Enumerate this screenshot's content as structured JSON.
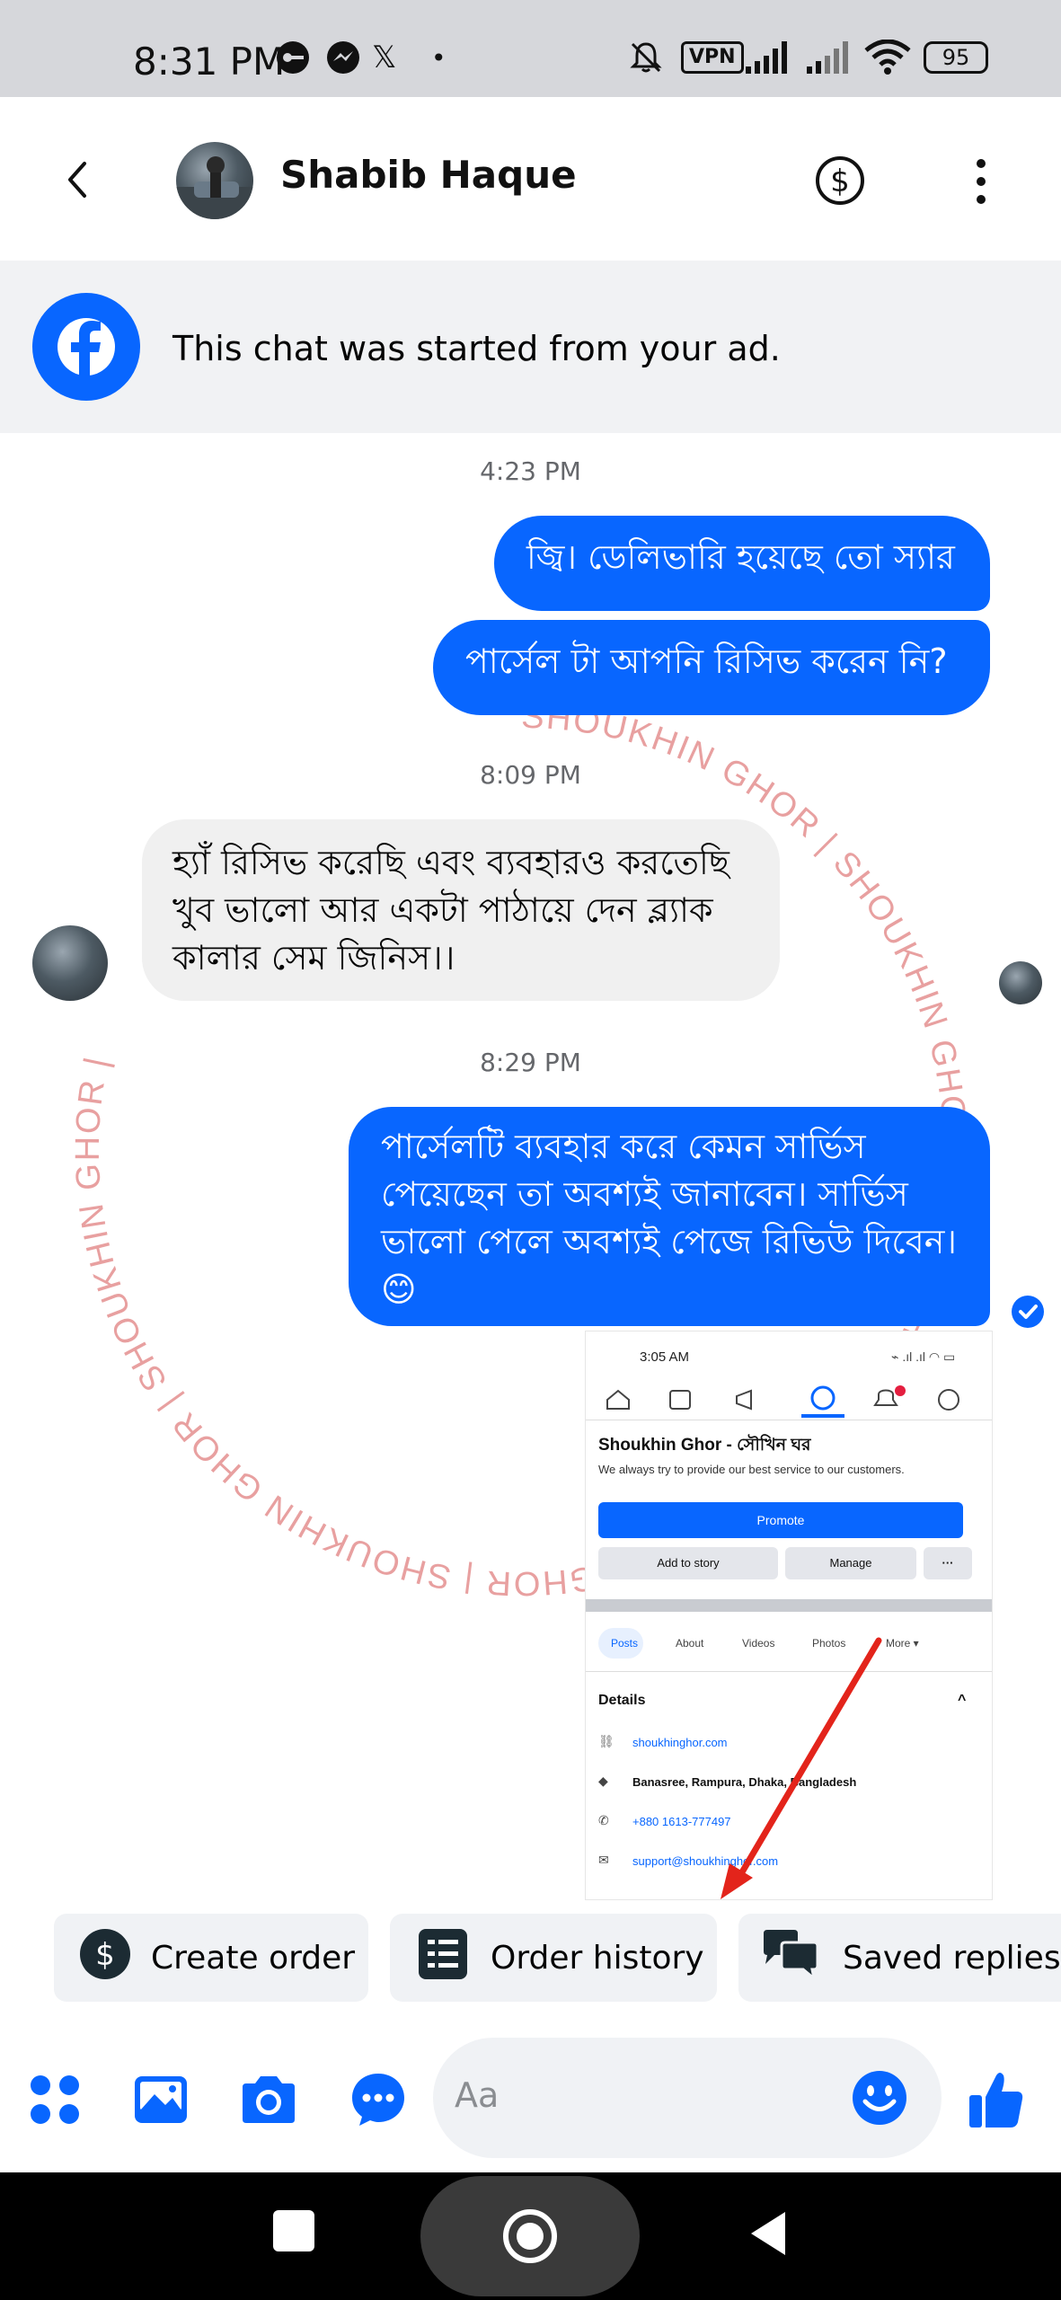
{
  "status_bar": {
    "time": "8:31 PM",
    "vpn": "VPN",
    "battery": "95"
  },
  "header": {
    "contact_name": "Shabib Haque",
    "icons": [
      "back-chevron-icon",
      "dollar-circle-icon",
      "more-vert-icon"
    ]
  },
  "ad_banner": {
    "text": "This chat was started from your ad.",
    "icon": "facebook-icon"
  },
  "messages": {
    "ts1": "4:23 PM",
    "out1": "জ্বি। ডেলিভারি হয়েছে তো স্যার",
    "out2": "পার্সেল টা আপনি রিসিভ করেন নি?",
    "ts2": "8:09 PM",
    "in1": "হ্যাঁ রিসিভ করেছি এবং ব্যবহারও করতেছি খুব ভালো আর একটা পাঠায়ে দেন ব্ল্যাক কালার সেম জিনিস।।",
    "ts3": "8:29 PM",
    "out3": "পার্সেলটি ব্যবহার করে কেমন সার্ভিস পেয়েছেন তা অবশ্যই জানাবেন। সার্ভিস ভালো পেলে অবশ্যই পেজে রিভিউ দিবেন।😊"
  },
  "watermark_text": "SHOUKHIN GHOR | SHOUKHIN GHOR | SHOUKHIN GHOR | SHOUKHIN GHOR | SHOUKHIN GHOR | SHOUKHIN GHOR |",
  "screenshot": {
    "time": "3:05 AM",
    "page_name": "Shoukhin Ghor - সৌখিন ঘর",
    "tagline": "We always try to provide our best service to our customers.",
    "promote": "Promote",
    "add_to_story": "Add to story",
    "manage": "Manage",
    "more_dots": "···",
    "tabs": [
      "Posts",
      "About",
      "Videos",
      "Photos",
      "More ▾"
    ],
    "details_title": "Details",
    "details_chevron": "^",
    "website": "shoukhinghor.com",
    "address": "Banasree, Rampura, Dhaka, Bangladesh",
    "phone": "+880 1613-777497",
    "email": "support@shoukhinghor.com"
  },
  "quick_replies": {
    "create_order": "Create order",
    "order_history": "Order history",
    "saved_replies": "Saved replies"
  },
  "composer": {
    "placeholder": "Aa"
  },
  "colors": {
    "accent": "#0866ff",
    "incoming_bubble": "#f0f0f0",
    "watermark": "#e8a0a0"
  }
}
